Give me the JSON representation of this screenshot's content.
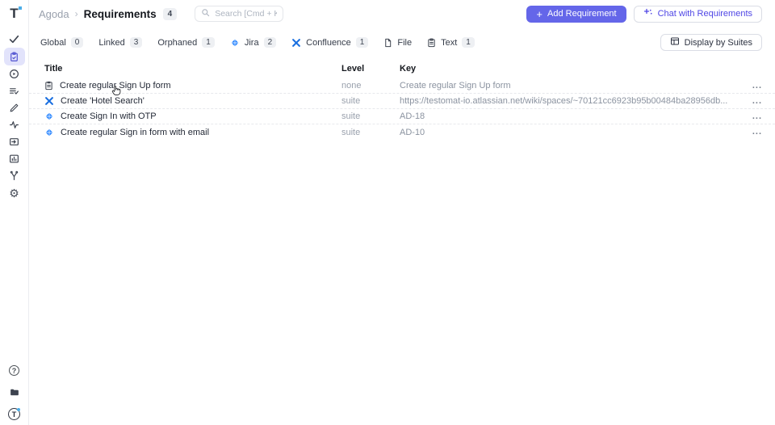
{
  "app": {
    "logo_letter": "T",
    "accent_color": "#6466e9",
    "jira_blue": "#2684FF",
    "confluence_blue": "#1a6fe0"
  },
  "sidebar": {
    "items": [
      "tests",
      "requirements",
      "runs",
      "plans",
      "editor",
      "pulse",
      "import",
      "analytics",
      "branches",
      "settings"
    ],
    "active_item": "requirements",
    "bottom_items": [
      "help",
      "projects",
      "profile"
    ],
    "profile_letter": "T"
  },
  "header": {
    "breadcrumb": {
      "project": "Agoda",
      "separator": "›",
      "page": "Requirements",
      "count": "4"
    },
    "search": {
      "placeholder": "Search [Cmd + K]"
    },
    "add_button": "Add Requirement",
    "add_plus": "+",
    "chat_button": "Chat with Requirements"
  },
  "filters": {
    "items": [
      {
        "label": "Global",
        "count": "0"
      },
      {
        "label": "Linked",
        "count": "3"
      },
      {
        "label": "Orphaned",
        "count": "1"
      },
      {
        "label": "Jira",
        "count": "2"
      },
      {
        "label": "Confluence",
        "count": "1"
      },
      {
        "label": "File",
        "count": ""
      },
      {
        "label": "Text",
        "count": "1"
      }
    ],
    "display_button": "Display by Suites"
  },
  "table": {
    "columns": {
      "title": "Title",
      "level": "Level",
      "key": "Key"
    },
    "menu_glyph": "...",
    "rows": [
      {
        "title": "Create regular Sign Up form",
        "level": "none",
        "key": "Create regular Sign Up form",
        "source": "text"
      },
      {
        "title": "Create 'Hotel Search'",
        "level": "suite",
        "key": "https://testomat-io.atlassian.net/wiki/spaces/~70121cc6923b95b00484ba28956db...",
        "source": "confluence"
      },
      {
        "title": "Create Sign In with OTP",
        "level": "suite",
        "key": "AD-18",
        "source": "jira"
      },
      {
        "title": "Create regular Sign in form with email",
        "level": "suite",
        "key": "AD-10",
        "source": "jira"
      }
    ]
  }
}
